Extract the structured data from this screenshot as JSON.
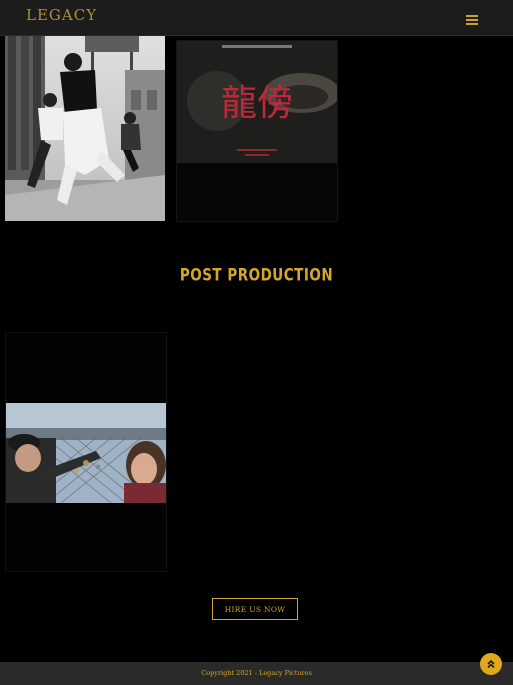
{
  "header": {
    "logo_text": "LEGACY",
    "menu_icon": "hamburger-menu-icon"
  },
  "gallery_top": [
    {
      "name": "black-and-white-dancers-still"
    },
    {
      "name": "movie-poster-dark-hat",
      "poster_title": "龍傍"
    }
  ],
  "section": {
    "title": "POST PRODUCTION"
  },
  "gallery_post": [
    {
      "name": "couple-on-bridge-still"
    }
  ],
  "cta": {
    "label": "HIRE US NOW"
  },
  "footer": {
    "copyright": "Copyright 2021 - Legacy Pictures"
  },
  "colors": {
    "accent": "#d4a72c",
    "background": "#000000",
    "header_bg": "#1c1c1c",
    "footer_bg": "#2a2a2a"
  },
  "scroll_top_icon": "double-chevron-up-icon"
}
